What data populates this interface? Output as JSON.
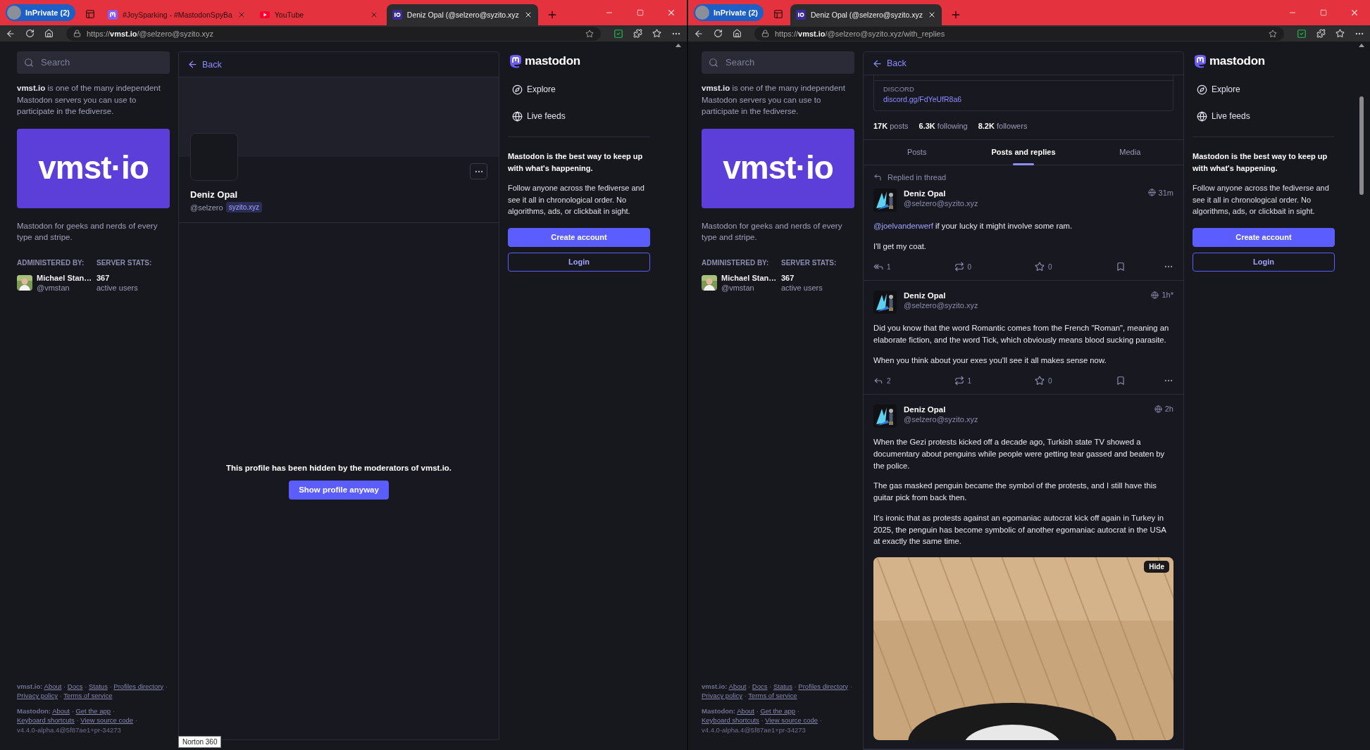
{
  "windows": [
    {
      "profile": "InPrivate (2)",
      "tabs": [
        {
          "title": "#JoySparking - #MastodonSpyBa",
          "kind": "mastodon",
          "selected": false
        },
        {
          "title": "YouTube",
          "kind": "video",
          "selected": false
        },
        {
          "title": "Deniz Opal (@selzero@syzito.xyz",
          "kind": "server",
          "selected": true
        }
      ],
      "url": "https://**vmst.io**/@selzero@syzito.xyz",
      "sidebar": {
        "search": {
          "placeholder": "Search"
        },
        "about": "**vmst.io** is one of the many independent Mastodon servers you can use to participate in the fediverse.",
        "banner_logo": "vmst·io",
        "description": "Mastodon for geeks and nerds of every type and stripe.",
        "admin": {
          "heading": "ADMINISTERED BY:",
          "name": "Michael Stan…",
          "handle": "@vmstan"
        },
        "stats": {
          "heading": "SERVER STATS:",
          "value": "367",
          "label": "active users"
        },
        "footer": [
          {
            "label": "vmst.io:",
            "links": [
              "About",
              "Docs",
              "Status",
              "Profiles directory",
              "Privacy policy",
              "Terms of service"
            ]
          },
          {
            "label": "Mastodon:",
            "links": [
              "About",
              "Get the app",
              "Keyboard shortcuts",
              "View source code"
            ],
            "version": "v4.4.0-alpha.4@5f87ae1+pr-34273"
          }
        ],
        "separator": "·"
      },
      "main": {
        "kind": "hidden_profile",
        "back": "Back",
        "name": "Deniz Opal",
        "handle": "@selzero",
        "domain": "syzito.xyz",
        "message": "This profile has been hidden by the moderators of vmst.io.",
        "button": "Show profile anyway"
      },
      "aside": {
        "logo": "mastodon",
        "nav": [
          {
            "label": "Explore"
          },
          {
            "label": "Live feeds"
          }
        ],
        "heading": "Mastodon is the best way to keep up with what's happening.",
        "text": "Follow anyone across the fediverse and see it all in chronological order. No algorithms, ads, or clickbait in sight.",
        "buttons": [
          {
            "label": "Create account",
            "kind": "primary"
          },
          {
            "label": "Login",
            "kind": "outline"
          }
        ]
      }
    },
    {
      "profile": "InPrivate (2)",
      "tabs": [
        {
          "title": "Deniz Opal (@selzero@syzito.xyz",
          "kind": "server",
          "selected": true
        }
      ],
      "url": "https://**vmst.io**/@selzero@syzito.xyz/with_replies",
      "sidebar": {
        "search": {
          "placeholder": "Search"
        },
        "about": "**vmst.io** is one of the many independent Mastodon servers you can use to participate in the fediverse.",
        "banner_logo": "vmst·io",
        "description": "Mastodon for geeks and nerds of every type and stripe.",
        "admin": {
          "heading": "ADMINISTERED BY:",
          "name": "Michael Stan…",
          "handle": "@vmstan"
        },
        "stats": {
          "heading": "SERVER STATS:",
          "value": "367",
          "label": "active users"
        },
        "footer": [
          {
            "label": "vmst.io:",
            "links": [
              "About",
              "Docs",
              "Status",
              "Profiles directory",
              "Privacy policy",
              "Terms of service"
            ]
          },
          {
            "label": "Mastodon:",
            "links": [
              "About",
              "Get the app",
              "Keyboard shortcuts",
              "View source code"
            ],
            "version": "v4.4.0-alpha.4@5f87ae1+pr-34273"
          }
        ],
        "separator": "·"
      },
      "main": {
        "kind": "timeline",
        "back": "Back",
        "field": {
          "name": "DISCORD",
          "value": "discord.gg/FdYeUfR8a6"
        },
        "stats": [
          {
            "count": "17K",
            "label": "posts"
          },
          {
            "count": "6.3K",
            "label": "following"
          },
          {
            "count": "8.2K",
            "label": "followers"
          }
        ],
        "tabs": [
          {
            "label": "Posts",
            "selected": false
          },
          {
            "label": "Posts and replies",
            "selected": true
          },
          {
            "label": "Media",
            "selected": false
          }
        ],
        "thread_note": "Replied in thread",
        "posts": [
          {
            "name": "Deniz Opal",
            "handle": "@selzero@syzito.xyz",
            "time": "31m",
            "mention": "@joelvanderwerf",
            "paragraphs": [
              "if your lucky it might involve some ram.",
              "I'll get my coat."
            ],
            "kind": "thread_reply",
            "replies": "1",
            "boosts": "0",
            "favourites": "0"
          },
          {
            "name": "Deniz Opal",
            "handle": "@selzero@syzito.xyz",
            "time": "1h*",
            "paragraphs": [
              "Did you know that the word Romantic comes from the French \"Roman\", meaning an elaborate fiction, and the word Tick, which obviously means blood sucking parasite.",
              "When you think about your exes you'll see it all makes sense now."
            ],
            "kind": "post",
            "replies": "2",
            "boosts": "1",
            "favourites": "0"
          },
          {
            "name": "Deniz Opal",
            "handle": "@selzero@syzito.xyz",
            "time": "2h",
            "paragraphs": [
              "When the Gezi protests kicked off a decade ago, Turkish state TV showed a documentary about penguins while people were getting tear gassed and beaten by the police.",
              "The gas masked penguin became the symbol of the protests, and I still have this guitar pick from back then.",
              "It's ironic that as protests against an egomaniac autocrat kick off again in Turkey in 2025, the penguin has become symbolic of another egomaniac autocrat in the USA at exactly the same time."
            ],
            "media": {
              "kind": "picture",
              "hide": "Hide"
            }
          }
        ]
      },
      "aside": {
        "logo": "mastodon",
        "nav": [
          {
            "label": "Explore"
          },
          {
            "label": "Live feeds"
          }
        ],
        "heading": "Mastodon is the best way to keep up with what's happening.",
        "text": "Follow anyone across the fediverse and see it all in chronological order. No algorithms, ads, or clickbait in sight.",
        "buttons": [
          {
            "label": "Create account",
            "kind": "primary"
          },
          {
            "label": "Login",
            "kind": "outline"
          }
        ]
      }
    }
  ],
  "tooltip": "Norton 360"
}
